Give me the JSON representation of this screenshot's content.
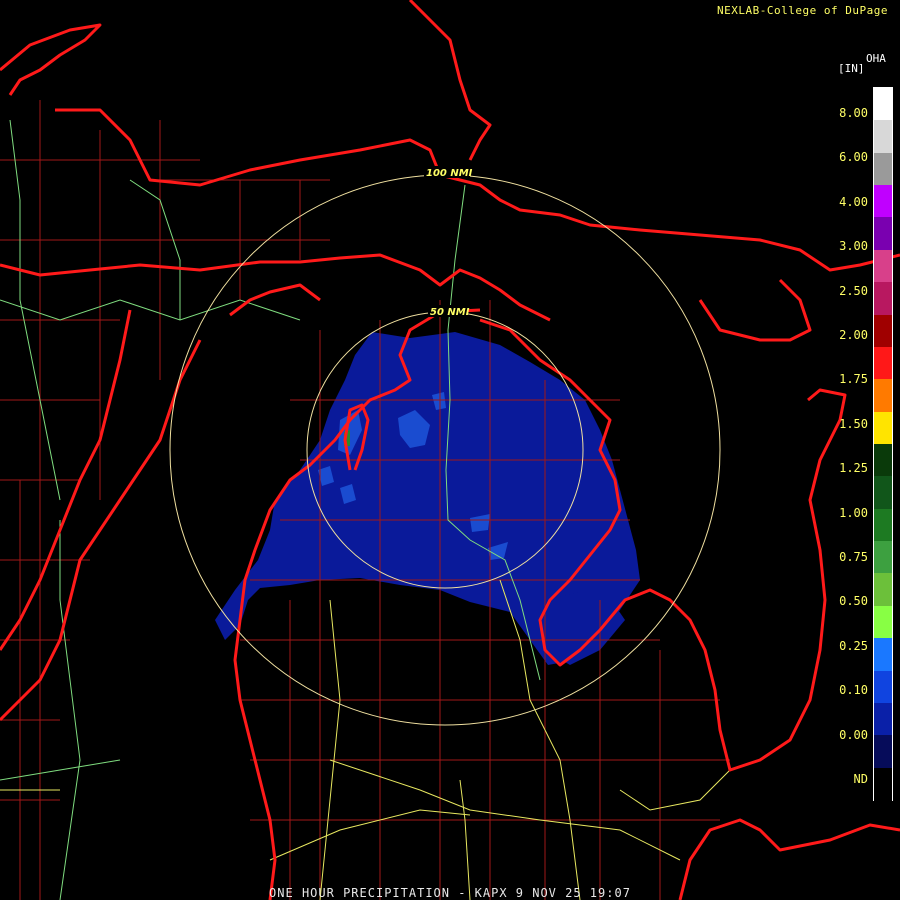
{
  "credit": "NEXLAB-College of DuPage",
  "footer": "ONE HOUR PRECIPITATION - KAPX 9 NOV 25 19:07",
  "legend": {
    "unit": "[IN]",
    "product": "OHA",
    "ticks": [
      "8.00",
      "6.00",
      "4.00",
      "3.00",
      "2.50",
      "2.00",
      "1.75",
      "1.50",
      "1.25",
      "1.00",
      "0.75",
      "0.50",
      "0.25",
      "0.10",
      "0.00",
      "ND"
    ],
    "colors": [
      "#ffffff",
      "#d8d8d8",
      "#9a9a9a",
      "#c000ff",
      "#7a00b0",
      "#d8408a",
      "#b81860",
      "#a00000",
      "#ff1818",
      "#ff7a00",
      "#ffe400",
      "#0a3a0a",
      "#11561a",
      "#1d7a22",
      "#3da040",
      "#6cc03a",
      "#88ff44",
      "#1a78ff",
      "#1044e0",
      "#0a20a8",
      "#060c5a",
      "#000000"
    ]
  },
  "rings": [
    "100 NMI",
    "50 NMI"
  ],
  "colors": {
    "borders": "#ff1a1a",
    "counties": "#a01818",
    "highways": "#7fdc7f",
    "roads": "#e8e860",
    "ring": "#f0e0a0",
    "precip_light": "#0a1a9a",
    "precip_mid": "#1a4cd0"
  }
}
